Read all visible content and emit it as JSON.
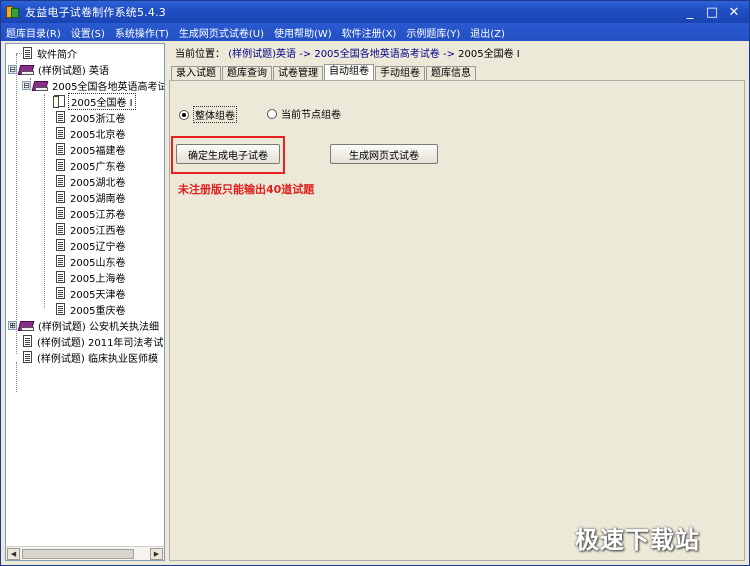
{
  "window": {
    "title": "友益电子试卷制作系统5.4.3",
    "minimize_glyph": "_",
    "maximize_glyph": "□",
    "close_glyph": "✕"
  },
  "menu": [
    "题库目录(R)",
    "设置(S)",
    "系统操作(T)",
    "生成网页式试卷(U)",
    "使用帮助(W)",
    "软件注册(X)",
    "示例题库(Y)",
    "退出(Z)"
  ],
  "tree": {
    "items": [
      {
        "label": "软件简介"
      },
      {
        "label": "(样例试题) 英语",
        "expander": "⊟"
      },
      {
        "label": "2005全国各地英语高考试",
        "expander": "⊟"
      },
      {
        "label": "2005全国卷 I"
      },
      {
        "label": "2005浙江卷"
      },
      {
        "label": "2005北京卷"
      },
      {
        "label": "2005福建卷"
      },
      {
        "label": "2005广东卷"
      },
      {
        "label": "2005湖北卷"
      },
      {
        "label": "2005湖南卷"
      },
      {
        "label": "2005江苏卷"
      },
      {
        "label": "2005江西卷"
      },
      {
        "label": "2005辽宁卷"
      },
      {
        "label": "2005山东卷"
      },
      {
        "label": "2005上海卷"
      },
      {
        "label": "2005天津卷"
      },
      {
        "label": "2005重庆卷"
      },
      {
        "label": "(样例试题) 公安机关执法细",
        "expander": "⊞"
      },
      {
        "label": "(样例试题) 2011年司法考试"
      },
      {
        "label": "(样例试题) 临床执业医师模"
      }
    ],
    "scroll_left": "◀",
    "scroll_right": "▶"
  },
  "location": {
    "prefix": "当前位置：",
    "path": "(样例试题)英语 -> 2005全国各地英语高考试卷 ->",
    "current": "2005全国卷 I"
  },
  "tabs": [
    "录入试题",
    "题库查询",
    "试卷管理",
    "自动组卷",
    "手动组卷",
    "题库信息"
  ],
  "active_tab": "自动组卷",
  "options": {
    "whole": "整体组卷",
    "node": "当前节点组卷",
    "selected": "整体组卷"
  },
  "buttons": {
    "generate_electronic": "确定生成电子试卷",
    "generate_web": "生成网页式试卷"
  },
  "warning": "未注册版只能输出40道试题",
  "watermark": "极速下载站",
  "colors": {
    "titlebar": "#1f4fc4",
    "warning": "#e02020",
    "highlight": "#e8211f"
  }
}
